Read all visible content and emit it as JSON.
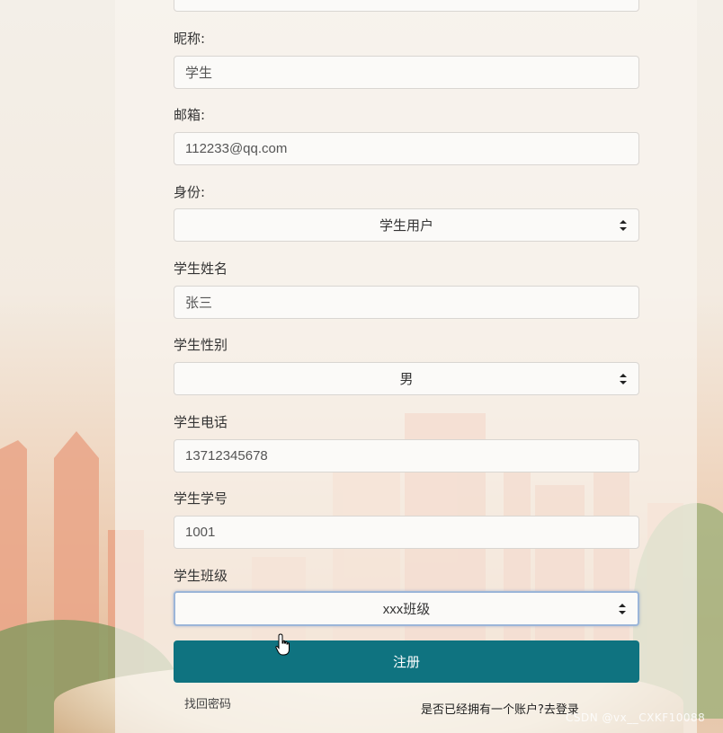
{
  "form": {
    "nickname": {
      "label": "昵称:",
      "value": "学生"
    },
    "email": {
      "label": "邮箱:",
      "value": "112233@qq.com"
    },
    "identity": {
      "label": "身份:",
      "selected": "学生用户"
    },
    "student_name": {
      "label": "学生姓名",
      "value": "张三"
    },
    "student_gender": {
      "label": "学生性别",
      "selected": "男"
    },
    "student_phone": {
      "label": "学生电话",
      "value": "13712345678"
    },
    "student_id": {
      "label": "学生学号",
      "value": "1001"
    },
    "student_class": {
      "label": "学生班级",
      "selected": "xxx班级"
    }
  },
  "actions": {
    "register_label": "注册",
    "forgot_password": "找回密码",
    "have_account": "是否已经拥有一个账户?去登录"
  },
  "watermark": "CSDN @vx__CXKF10088",
  "colors": {
    "primary": "#0f7380",
    "focus_border": "#9bb5d8"
  }
}
